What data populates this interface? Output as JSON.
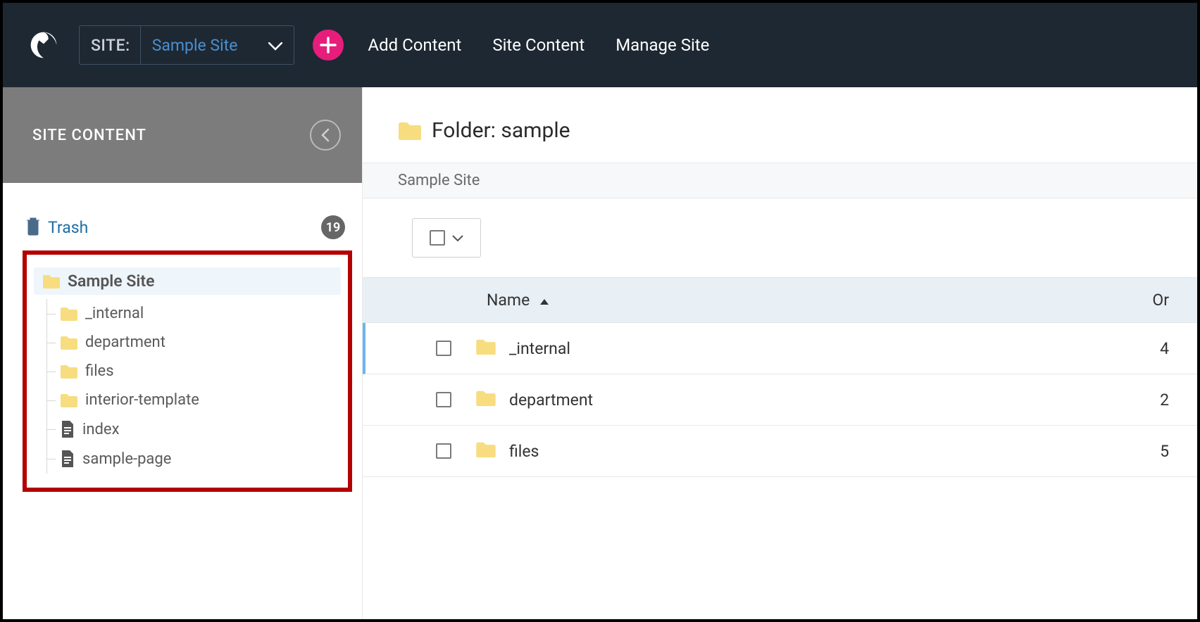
{
  "topbar": {
    "site_label": "SITE:",
    "site_value": "Sample Site",
    "add_label": "Add Content",
    "nav": [
      "Site Content",
      "Manage Site"
    ]
  },
  "sidebar": {
    "title": "SITE CONTENT",
    "trash_label": "Trash",
    "trash_count": "19",
    "root": "Sample Site",
    "items": [
      {
        "label": "_internal",
        "type": "folder"
      },
      {
        "label": "department",
        "type": "folder"
      },
      {
        "label": "files",
        "type": "folder"
      },
      {
        "label": "interior-template",
        "type": "folder"
      },
      {
        "label": "index",
        "type": "page"
      },
      {
        "label": "sample-page",
        "type": "page"
      }
    ]
  },
  "main": {
    "title": "Folder: sample",
    "breadcrumb": "Sample Site",
    "columns": {
      "name": "Name",
      "col2": "Or"
    },
    "rows": [
      {
        "name": "_internal",
        "col2": "4",
        "selected": true
      },
      {
        "name": "department",
        "col2": "2",
        "selected": false
      },
      {
        "name": "files",
        "col2": "5",
        "selected": false
      }
    ]
  },
  "colors": {
    "folder": "#f7dd80",
    "accent": "#e61d7b",
    "link": "#206ea6"
  }
}
